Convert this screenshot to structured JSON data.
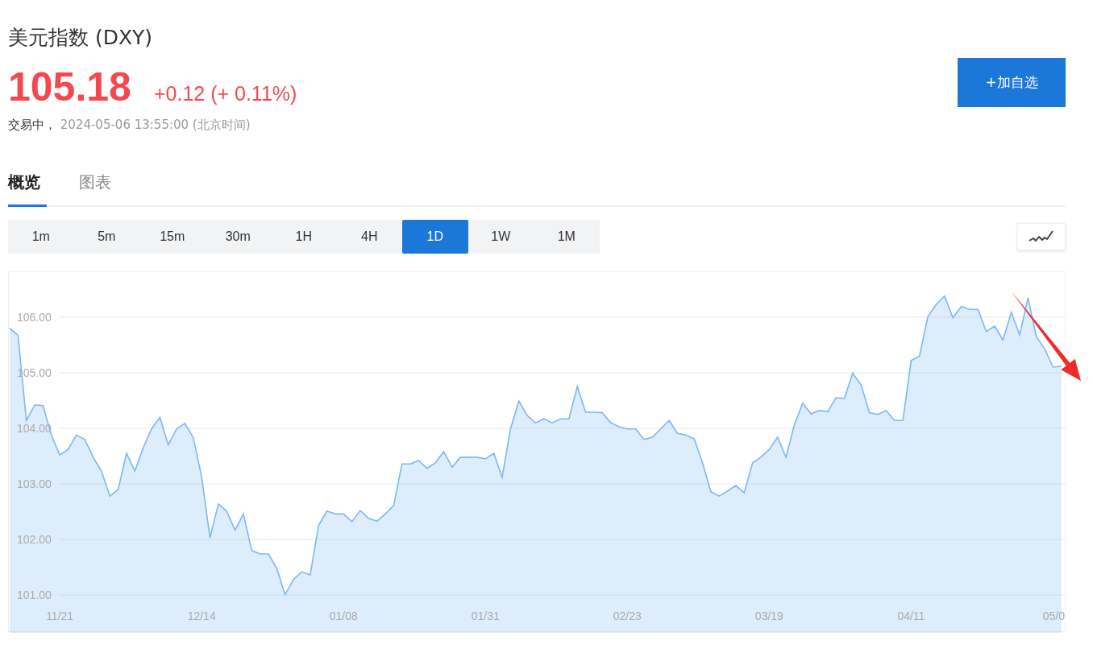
{
  "header": {
    "title": "美元指数 (DXY)",
    "price": "105.18",
    "change": "+0.12 (+ 0.11%)",
    "status": "交易中，",
    "timestamp": "2024-05-06 13:55:00 (北京时间)"
  },
  "watchlist_button": {
    "label": "+加自选"
  },
  "tabs": [
    {
      "label": "概览",
      "selected": true
    },
    {
      "label": "图表",
      "selected": false
    }
  ],
  "intervals": [
    {
      "label": "1m",
      "selected": false
    },
    {
      "label": "5m",
      "selected": false
    },
    {
      "label": "15m",
      "selected": false
    },
    {
      "label": "30m",
      "selected": false
    },
    {
      "label": "1H",
      "selected": false
    },
    {
      "label": "4H",
      "selected": false
    },
    {
      "label": "1D",
      "selected": true
    },
    {
      "label": "1W",
      "selected": false
    },
    {
      "label": "1M",
      "selected": false
    }
  ],
  "chart_data": {
    "type": "area",
    "grid": true,
    "ylim": [
      100.32,
      106.81
    ],
    "categories": [
      null,
      null,
      null,
      null,
      null,
      null,
      "11/21",
      null,
      null,
      null,
      null,
      null,
      null,
      null,
      null,
      null,
      null,
      null,
      null,
      null,
      null,
      null,
      null,
      "12/14",
      null,
      null,
      null,
      null,
      null,
      null,
      null,
      null,
      null,
      null,
      null,
      null,
      null,
      null,
      null,
      null,
      "01/08",
      null,
      null,
      null,
      null,
      null,
      null,
      null,
      null,
      null,
      null,
      null,
      null,
      null,
      null,
      null,
      null,
      "01/31",
      null,
      null,
      null,
      null,
      null,
      null,
      null,
      null,
      null,
      null,
      null,
      null,
      null,
      null,
      null,
      null,
      "02/23",
      null,
      null,
      null,
      null,
      null,
      null,
      null,
      null,
      null,
      null,
      null,
      null,
      null,
      null,
      null,
      null,
      "03/19",
      null,
      null,
      null,
      null,
      null,
      null,
      null,
      null,
      null,
      null,
      null,
      null,
      null,
      null,
      null,
      null,
      "04/11",
      null,
      null,
      null,
      null,
      null,
      null,
      null,
      null,
      null,
      null,
      null,
      null,
      null,
      null,
      null,
      null,
      "05/0",
      null
    ],
    "yticks": [
      {
        "value": 106,
        "label": "106.00"
      },
      {
        "value": 105,
        "label": "105.00"
      },
      {
        "value": 104,
        "label": "104.00"
      },
      {
        "value": 103,
        "label": "103.00"
      },
      {
        "value": 102,
        "label": "102.00"
      },
      {
        "value": 101,
        "label": "101.00"
      }
    ],
    "series": [
      {
        "color": "#7ab8f5",
        "values": [
          105.8,
          105.67,
          104.14,
          104.42,
          104.41,
          103.87,
          103.52,
          103.62,
          103.88,
          103.8,
          103.48,
          103.23,
          102.78,
          102.9,
          103.55,
          103.23,
          103.65,
          103.99,
          104.2,
          103.7,
          103.99,
          104.09,
          103.83,
          103.12,
          102.03,
          102.64,
          102.51,
          102.17,
          102.46,
          101.8,
          101.74,
          101.74,
          101.48,
          101.01,
          101.28,
          101.42,
          101.36,
          102.25,
          102.51,
          102.46,
          102.46,
          102.32,
          102.52,
          102.38,
          102.33,
          102.46,
          102.61,
          103.36,
          103.36,
          103.42,
          103.28,
          103.38,
          103.58,
          103.3,
          103.48,
          103.48,
          103.48,
          103.45,
          103.55,
          103.12,
          103.99,
          104.49,
          104.23,
          104.1,
          104.17,
          104.1,
          104.17,
          104.17,
          104.75,
          104.29,
          104.29,
          104.28,
          104.1,
          104.03,
          103.99,
          103.99,
          103.8,
          103.84,
          103.99,
          104.14,
          103.91,
          103.88,
          103.81,
          103.38,
          102.86,
          102.78,
          102.87,
          102.97,
          102.84,
          103.38,
          103.48,
          103.62,
          103.84,
          103.48,
          104.06,
          104.45,
          104.26,
          104.32,
          104.3,
          104.55,
          104.54,
          104.99,
          104.78,
          104.28,
          104.25,
          104.32,
          104.14,
          104.14,
          105.22,
          105.3,
          106.01,
          106.23,
          106.38,
          105.99,
          106.19,
          106.14,
          106.14,
          105.74,
          105.84,
          105.59,
          106.09,
          105.68,
          106.35,
          105.65,
          105.43,
          105.1,
          105.12
        ]
      }
    ]
  },
  "overlay_arrow": {
    "color": "#ee2c2c"
  }
}
